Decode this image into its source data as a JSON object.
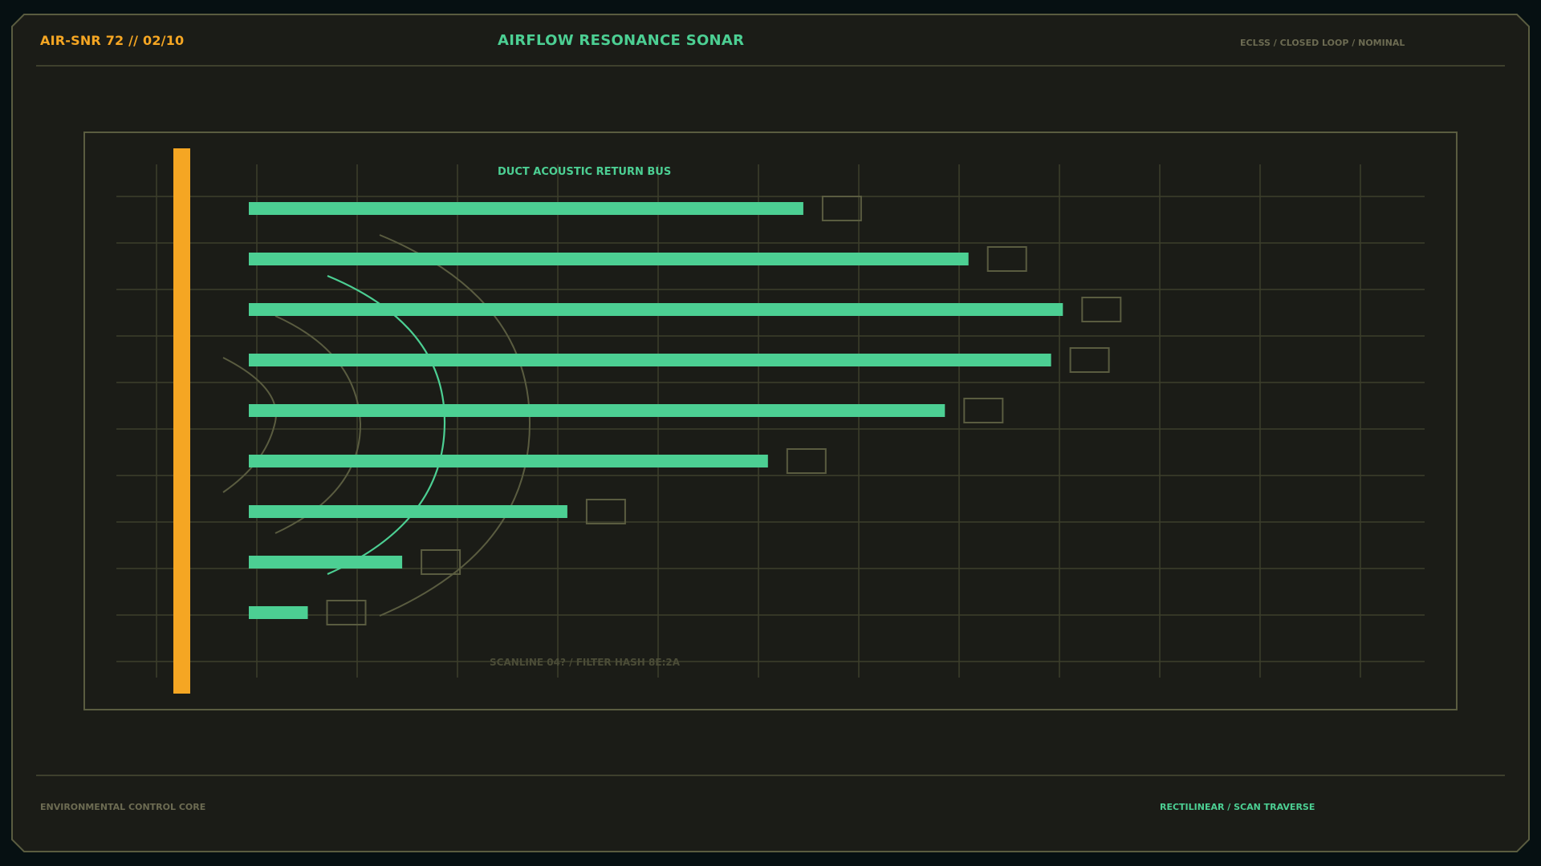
{
  "header": {
    "unit_id": "AIR-SNR 72 // 02/10",
    "title": "AIRFLOW RESONANCE SONAR",
    "system_status": "ECLSS / CLOSED LOOP / NOMINAL"
  },
  "panel": {
    "bus_label": "DUCT ACOUSTIC RETURN BUS",
    "scan_label": "SCANLINE 04? / FILTER HASH 8E:2A"
  },
  "footer": {
    "left_label": "ENVIRONMENTAL CONTROL CORE",
    "right_label": "RECTILINEAR / SCAN TRAVERSE"
  },
  "chart_data": {
    "type": "bar",
    "orientation": "horizontal",
    "values": [
      0.47,
      0.61,
      0.69,
      0.68,
      0.59,
      0.44,
      0.27,
      0.13,
      0.05
    ]
  },
  "colors": {
    "background": "#1b1c17",
    "outer": "#061012",
    "frame_line": "#5a5c40",
    "grid_line": "#3d3f2c",
    "accent_green": "#4ccf93",
    "accent_orange": "#f5a623",
    "muted_text": "#6c6b52"
  }
}
